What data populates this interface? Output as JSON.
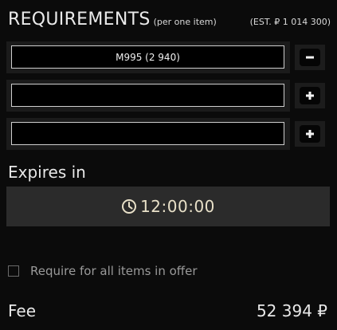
{
  "header": {
    "title": "REQUIREMENTS",
    "subtitle": "(per one item)",
    "estimate": "(EST. ₽ 1 014 300)"
  },
  "requirements": [
    {
      "value": "M995 (2 940)",
      "button": "remove",
      "button_icon": "minus-icon"
    },
    {
      "value": "",
      "button": "add",
      "button_icon": "plus-icon"
    },
    {
      "value": "",
      "button": "add",
      "button_icon": "plus-icon"
    }
  ],
  "expires": {
    "label": "Expires in",
    "time": "12:00:00",
    "icon": "clock-icon"
  },
  "options": {
    "require_all_label": "Require for all items in offer",
    "require_all_checked": false
  },
  "fee": {
    "label": "Fee",
    "value": "52 394 ₽"
  }
}
